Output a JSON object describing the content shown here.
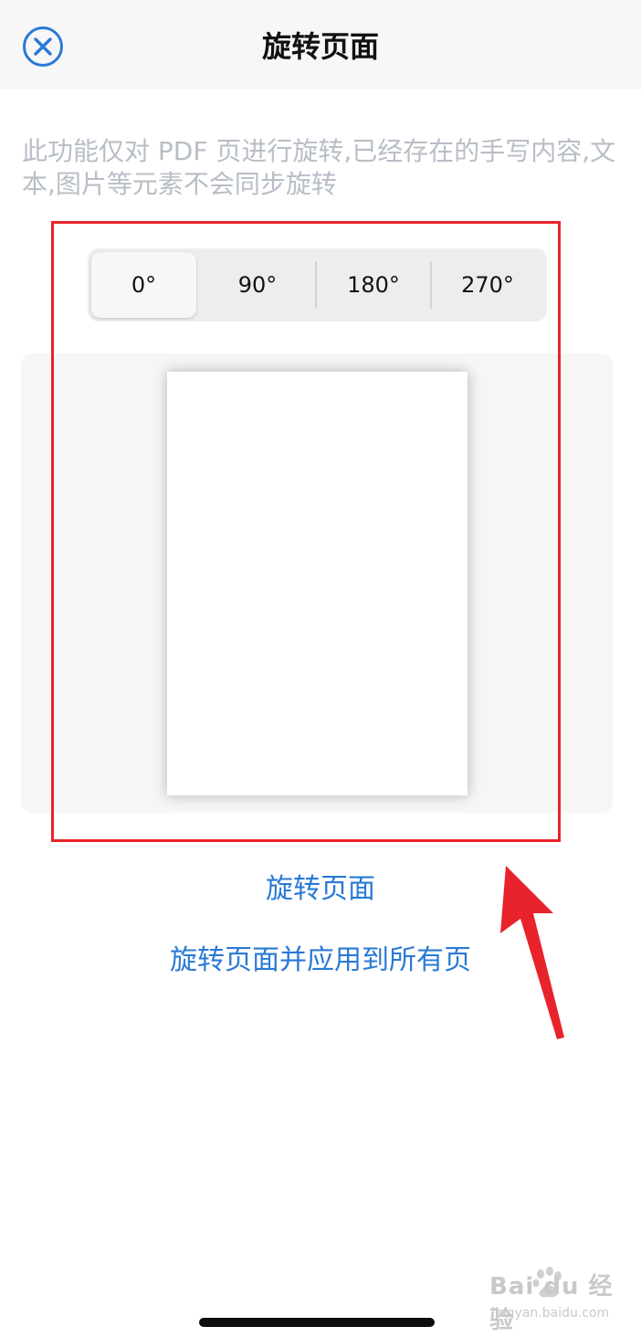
{
  "header": {
    "title": "旋转页面",
    "close_icon": "close-circle-icon"
  },
  "description": "此功能仅对 PDF 页进行旋转,已经存在的手写内容,文本,图片等元素不会同步旋转",
  "rotation": {
    "options": [
      "0°",
      "90°",
      "180°",
      "270°"
    ],
    "selected": "0°"
  },
  "actions": {
    "rotate_page": "旋转页面",
    "rotate_all": "旋转页面并应用到所有页"
  },
  "watermark": {
    "main": "Bai du 经验",
    "sub": "jingyan.baidu.com"
  },
  "colors": {
    "accent": "#2a79d6",
    "annotation": "#e8232b",
    "description_text": "#b8bec6"
  }
}
